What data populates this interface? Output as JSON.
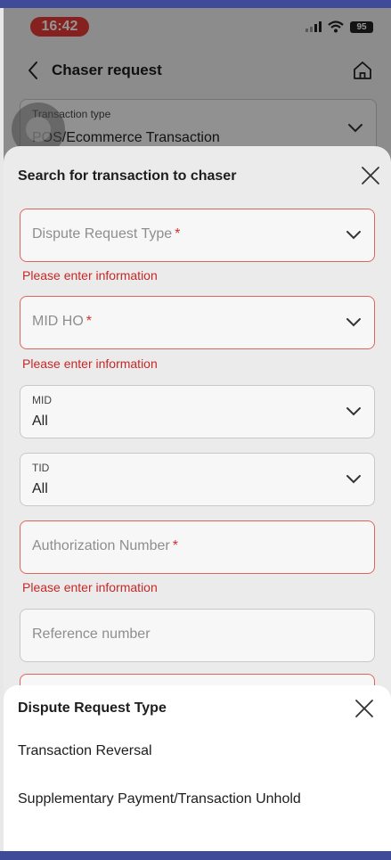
{
  "status_bar": {
    "time": "16:42",
    "battery": "95"
  },
  "header": {
    "title": "Chaser request"
  },
  "transaction_type": {
    "label": "Transaction type",
    "value": "POS/Ecommerce Transaction"
  },
  "search_sheet": {
    "title": "Search for transaction to chaser",
    "fields": {
      "dispute_request_type": {
        "placeholder": "Dispute Request Type",
        "required_mark": "*",
        "error": "Please enter information"
      },
      "mid_ho": {
        "placeholder": "MID HO",
        "required_mark": "*",
        "error": "Please enter information"
      },
      "mid": {
        "label": "MID",
        "value": "All"
      },
      "tid": {
        "label": "TID",
        "value": "All"
      },
      "authorization_number": {
        "placeholder": "Authorization Number",
        "required_mark": "*",
        "error": "Please enter information"
      },
      "reference_number": {
        "placeholder": "Reference number"
      }
    }
  },
  "dropdown_sheet": {
    "title": "Dispute Request Type",
    "options": [
      "Transaction Reversal",
      "Supplementary Payment/Transaction Unhold"
    ]
  },
  "colors": {
    "accent_bar": "#3f4a99",
    "error": "#c62828",
    "time_pill": "#e53935"
  },
  "icons": [
    "back-arrow-icon",
    "home-icon",
    "chevron-down-icon",
    "close-icon",
    "wifi-icon",
    "signal-icon",
    "battery-icon"
  ]
}
